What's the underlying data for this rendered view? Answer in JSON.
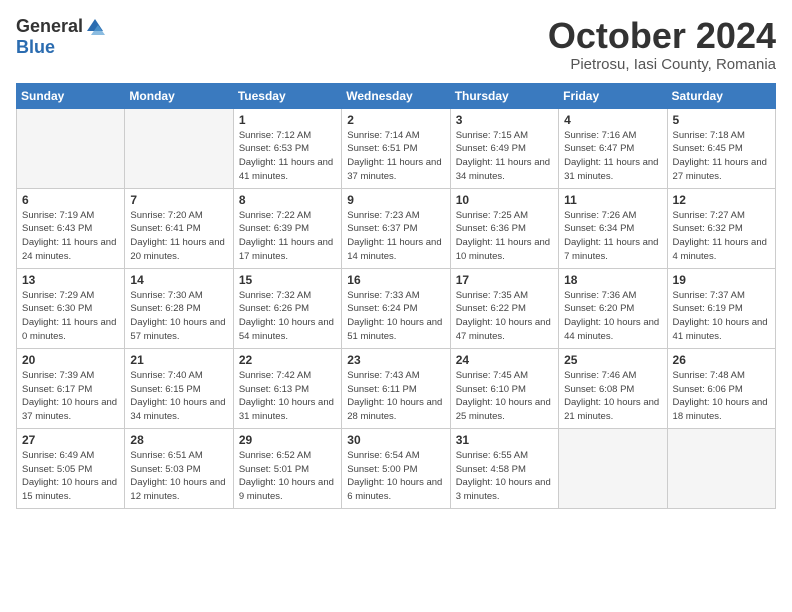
{
  "header": {
    "logo_general": "General",
    "logo_blue": "Blue",
    "month_title": "October 2024",
    "location": "Pietrosu, Iasi County, Romania"
  },
  "days_of_week": [
    "Sunday",
    "Monday",
    "Tuesday",
    "Wednesday",
    "Thursday",
    "Friday",
    "Saturday"
  ],
  "weeks": [
    [
      {
        "day": "",
        "empty": true
      },
      {
        "day": "",
        "empty": true
      },
      {
        "day": "1",
        "sunrise": "Sunrise: 7:12 AM",
        "sunset": "Sunset: 6:53 PM",
        "daylight": "Daylight: 11 hours and 41 minutes."
      },
      {
        "day": "2",
        "sunrise": "Sunrise: 7:14 AM",
        "sunset": "Sunset: 6:51 PM",
        "daylight": "Daylight: 11 hours and 37 minutes."
      },
      {
        "day": "3",
        "sunrise": "Sunrise: 7:15 AM",
        "sunset": "Sunset: 6:49 PM",
        "daylight": "Daylight: 11 hours and 34 minutes."
      },
      {
        "day": "4",
        "sunrise": "Sunrise: 7:16 AM",
        "sunset": "Sunset: 6:47 PM",
        "daylight": "Daylight: 11 hours and 31 minutes."
      },
      {
        "day": "5",
        "sunrise": "Sunrise: 7:18 AM",
        "sunset": "Sunset: 6:45 PM",
        "daylight": "Daylight: 11 hours and 27 minutes."
      }
    ],
    [
      {
        "day": "6",
        "sunrise": "Sunrise: 7:19 AM",
        "sunset": "Sunset: 6:43 PM",
        "daylight": "Daylight: 11 hours and 24 minutes."
      },
      {
        "day": "7",
        "sunrise": "Sunrise: 7:20 AM",
        "sunset": "Sunset: 6:41 PM",
        "daylight": "Daylight: 11 hours and 20 minutes."
      },
      {
        "day": "8",
        "sunrise": "Sunrise: 7:22 AM",
        "sunset": "Sunset: 6:39 PM",
        "daylight": "Daylight: 11 hours and 17 minutes."
      },
      {
        "day": "9",
        "sunrise": "Sunrise: 7:23 AM",
        "sunset": "Sunset: 6:37 PM",
        "daylight": "Daylight: 11 hours and 14 minutes."
      },
      {
        "day": "10",
        "sunrise": "Sunrise: 7:25 AM",
        "sunset": "Sunset: 6:36 PM",
        "daylight": "Daylight: 11 hours and 10 minutes."
      },
      {
        "day": "11",
        "sunrise": "Sunrise: 7:26 AM",
        "sunset": "Sunset: 6:34 PM",
        "daylight": "Daylight: 11 hours and 7 minutes."
      },
      {
        "day": "12",
        "sunrise": "Sunrise: 7:27 AM",
        "sunset": "Sunset: 6:32 PM",
        "daylight": "Daylight: 11 hours and 4 minutes."
      }
    ],
    [
      {
        "day": "13",
        "sunrise": "Sunrise: 7:29 AM",
        "sunset": "Sunset: 6:30 PM",
        "daylight": "Daylight: 11 hours and 0 minutes."
      },
      {
        "day": "14",
        "sunrise": "Sunrise: 7:30 AM",
        "sunset": "Sunset: 6:28 PM",
        "daylight": "Daylight: 10 hours and 57 minutes."
      },
      {
        "day": "15",
        "sunrise": "Sunrise: 7:32 AM",
        "sunset": "Sunset: 6:26 PM",
        "daylight": "Daylight: 10 hours and 54 minutes."
      },
      {
        "day": "16",
        "sunrise": "Sunrise: 7:33 AM",
        "sunset": "Sunset: 6:24 PM",
        "daylight": "Daylight: 10 hours and 51 minutes."
      },
      {
        "day": "17",
        "sunrise": "Sunrise: 7:35 AM",
        "sunset": "Sunset: 6:22 PM",
        "daylight": "Daylight: 10 hours and 47 minutes."
      },
      {
        "day": "18",
        "sunrise": "Sunrise: 7:36 AM",
        "sunset": "Sunset: 6:20 PM",
        "daylight": "Daylight: 10 hours and 44 minutes."
      },
      {
        "day": "19",
        "sunrise": "Sunrise: 7:37 AM",
        "sunset": "Sunset: 6:19 PM",
        "daylight": "Daylight: 10 hours and 41 minutes."
      }
    ],
    [
      {
        "day": "20",
        "sunrise": "Sunrise: 7:39 AM",
        "sunset": "Sunset: 6:17 PM",
        "daylight": "Daylight: 10 hours and 37 minutes."
      },
      {
        "day": "21",
        "sunrise": "Sunrise: 7:40 AM",
        "sunset": "Sunset: 6:15 PM",
        "daylight": "Daylight: 10 hours and 34 minutes."
      },
      {
        "day": "22",
        "sunrise": "Sunrise: 7:42 AM",
        "sunset": "Sunset: 6:13 PM",
        "daylight": "Daylight: 10 hours and 31 minutes."
      },
      {
        "day": "23",
        "sunrise": "Sunrise: 7:43 AM",
        "sunset": "Sunset: 6:11 PM",
        "daylight": "Daylight: 10 hours and 28 minutes."
      },
      {
        "day": "24",
        "sunrise": "Sunrise: 7:45 AM",
        "sunset": "Sunset: 6:10 PM",
        "daylight": "Daylight: 10 hours and 25 minutes."
      },
      {
        "day": "25",
        "sunrise": "Sunrise: 7:46 AM",
        "sunset": "Sunset: 6:08 PM",
        "daylight": "Daylight: 10 hours and 21 minutes."
      },
      {
        "day": "26",
        "sunrise": "Sunrise: 7:48 AM",
        "sunset": "Sunset: 6:06 PM",
        "daylight": "Daylight: 10 hours and 18 minutes."
      }
    ],
    [
      {
        "day": "27",
        "sunrise": "Sunrise: 6:49 AM",
        "sunset": "Sunset: 5:05 PM",
        "daylight": "Daylight: 10 hours and 15 minutes."
      },
      {
        "day": "28",
        "sunrise": "Sunrise: 6:51 AM",
        "sunset": "Sunset: 5:03 PM",
        "daylight": "Daylight: 10 hours and 12 minutes."
      },
      {
        "day": "29",
        "sunrise": "Sunrise: 6:52 AM",
        "sunset": "Sunset: 5:01 PM",
        "daylight": "Daylight: 10 hours and 9 minutes."
      },
      {
        "day": "30",
        "sunrise": "Sunrise: 6:54 AM",
        "sunset": "Sunset: 5:00 PM",
        "daylight": "Daylight: 10 hours and 6 minutes."
      },
      {
        "day": "31",
        "sunrise": "Sunrise: 6:55 AM",
        "sunset": "Sunset: 4:58 PM",
        "daylight": "Daylight: 10 hours and 3 minutes."
      },
      {
        "day": "",
        "empty": true
      },
      {
        "day": "",
        "empty": true
      }
    ]
  ]
}
